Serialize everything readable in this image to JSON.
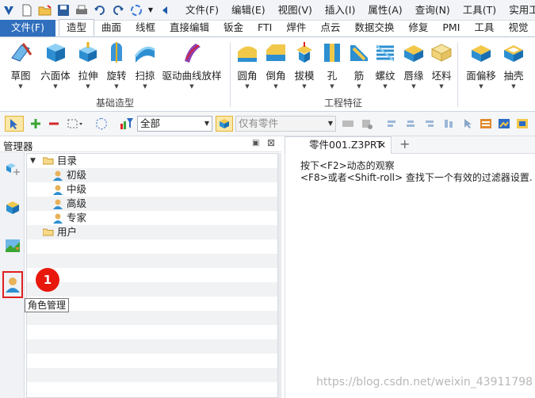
{
  "menubar": {
    "quick_access_icons": [
      "app-logo-icon",
      "new-file-icon",
      "open-folder-icon",
      "save-icon",
      "print-icon",
      "undo-icon",
      "redo-icon",
      "rotate-icon",
      "dropdown-icon",
      "collapse-arrow-icon"
    ],
    "items": [
      "文件(F)",
      "编辑(E)",
      "视图(V)",
      "插入(I)",
      "属性(A)",
      "查询(N)",
      "工具(T)",
      "实用工具"
    ]
  },
  "ribbon_tabs": {
    "file": "文件(F)",
    "items": [
      "造型",
      "曲面",
      "线框",
      "直接编辑",
      "钣金",
      "FTI",
      "焊件",
      "点云",
      "数据交换",
      "修复",
      "PMI",
      "工具",
      "视觉"
    ],
    "active": "造型"
  },
  "ribbon": {
    "basic_group": {
      "label": "基础造型",
      "buttons": [
        "草图",
        "六面体",
        "拉伸",
        "旋转",
        "扫掠",
        "驱动曲线放样"
      ]
    },
    "feature_group": {
      "label": "工程特征",
      "buttons": [
        "圆角",
        "倒角",
        "拔模",
        "孔",
        "筋",
        "螺纹",
        "唇缘",
        "坯料"
      ]
    },
    "extra_buttons": [
      "面偏移",
      "抽壳"
    ]
  },
  "toolbar": {
    "filter_value": "全部",
    "part_value": "仅有零件"
  },
  "manager": {
    "title": "管理器",
    "tree": [
      {
        "label": "目录",
        "type": "folder",
        "level": 0,
        "expanded": true
      },
      {
        "label": "初级",
        "type": "user",
        "level": 1
      },
      {
        "label": "中级",
        "type": "user",
        "level": 1
      },
      {
        "label": "高级",
        "type": "user",
        "level": 1
      },
      {
        "label": "专家",
        "type": "user",
        "level": 1
      },
      {
        "label": "用户",
        "type": "folder",
        "level": 0,
        "expanded": false
      }
    ],
    "tooltip": "角色管理",
    "badge": "1"
  },
  "document": {
    "tab_label": "零件001.Z3PRT",
    "hint_line1": "按下<F2>动态的观察",
    "hint_line2": "<F8>或者<Shift-roll> 查找下一个有效的过滤器设置."
  },
  "watermark": "https://blog.csdn.net/weixin_43911798",
  "colors": {
    "file_tab": "#2f6fbd",
    "badge": "#e8180c",
    "highlight_border": "#e02020"
  }
}
